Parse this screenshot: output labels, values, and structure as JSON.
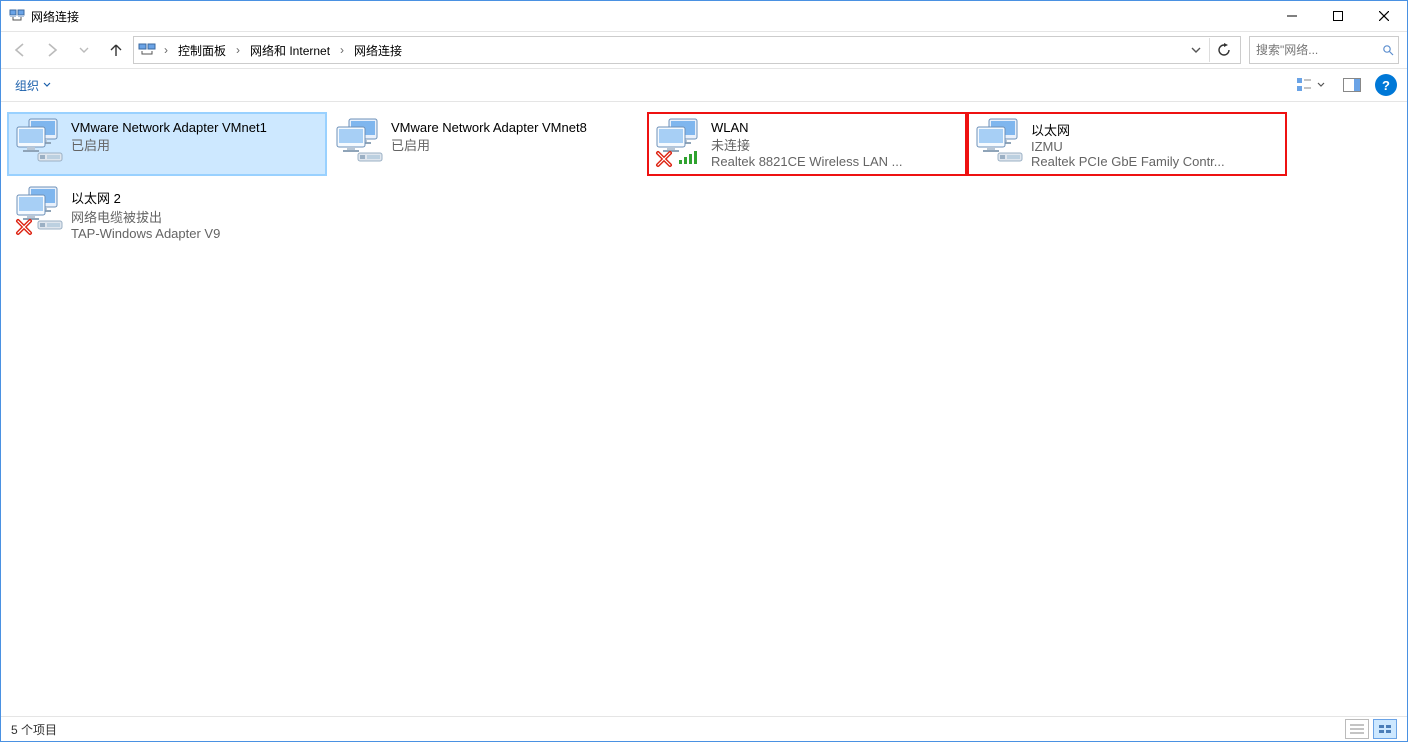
{
  "window": {
    "title": "网络连接"
  },
  "breadcrumb": {
    "root_sep": "›",
    "items": [
      "控制面板",
      "网络和 Internet",
      "网络连接"
    ]
  },
  "search": {
    "placeholder": "搜索\"网络..."
  },
  "cmdbar": {
    "organize": "组织"
  },
  "connections": [
    {
      "name": "VMware Network Adapter VMnet1",
      "status": "已启用",
      "device": "",
      "selected": true,
      "highlighted": false,
      "overlay": "nic"
    },
    {
      "name": "VMware Network Adapter VMnet8",
      "status": "已启用",
      "device": "",
      "selected": false,
      "highlighted": false,
      "overlay": "nic"
    },
    {
      "name": "WLAN",
      "status": "未连接",
      "device": "Realtek 8821CE Wireless LAN ...",
      "selected": false,
      "highlighted": true,
      "overlay": "wifi-x"
    },
    {
      "name": "以太网",
      "status": "IZMU",
      "device": "Realtek PCIe GbE Family Contr...",
      "selected": false,
      "highlighted": true,
      "overlay": "nic"
    },
    {
      "name": "以太网 2",
      "status": "网络电缆被拔出",
      "device": "TAP-Windows Adapter V9",
      "selected": false,
      "highlighted": false,
      "overlay": "nic-x"
    }
  ],
  "statusbar": {
    "text": "5 个项目"
  }
}
